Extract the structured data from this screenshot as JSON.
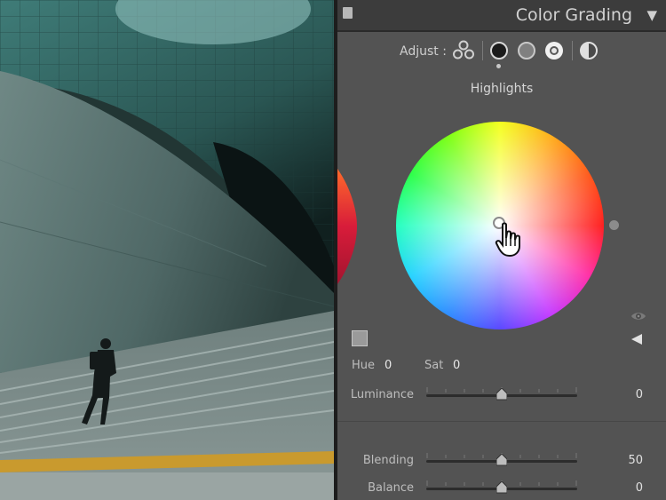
{
  "panel": {
    "title": "Color Grading",
    "collapse_icon": "triangle-down-icon",
    "toggle_icon": "panel-toggle-switch"
  },
  "adjust": {
    "label": "Adjust :",
    "modes": [
      {
        "name": "3-way",
        "icon": "three-circles-icon"
      },
      {
        "name": "shadows",
        "icon": "dark-circle-icon"
      },
      {
        "name": "midtones",
        "icon": "gray-circle-icon"
      },
      {
        "name": "highlights",
        "icon": "light-circle-icon"
      },
      {
        "name": "global",
        "icon": "half-circle-icon"
      }
    ],
    "active_indicator": "shadows"
  },
  "wheel": {
    "title": "Highlights",
    "hue_label": "Hue",
    "hue_value": "0",
    "sat_label": "Sat",
    "sat_value": "0"
  },
  "sliders": {
    "luminance": {
      "label": "Luminance",
      "value": "0",
      "position": 0.5
    },
    "blending": {
      "label": "Blending",
      "value": "50",
      "position": 0.5
    },
    "balance": {
      "label": "Balance",
      "value": "0",
      "position": 0.5
    }
  },
  "colors": {
    "panel_bg": "#535353",
    "header_bg": "#3c3c3c",
    "text": "#d2d2d2"
  }
}
